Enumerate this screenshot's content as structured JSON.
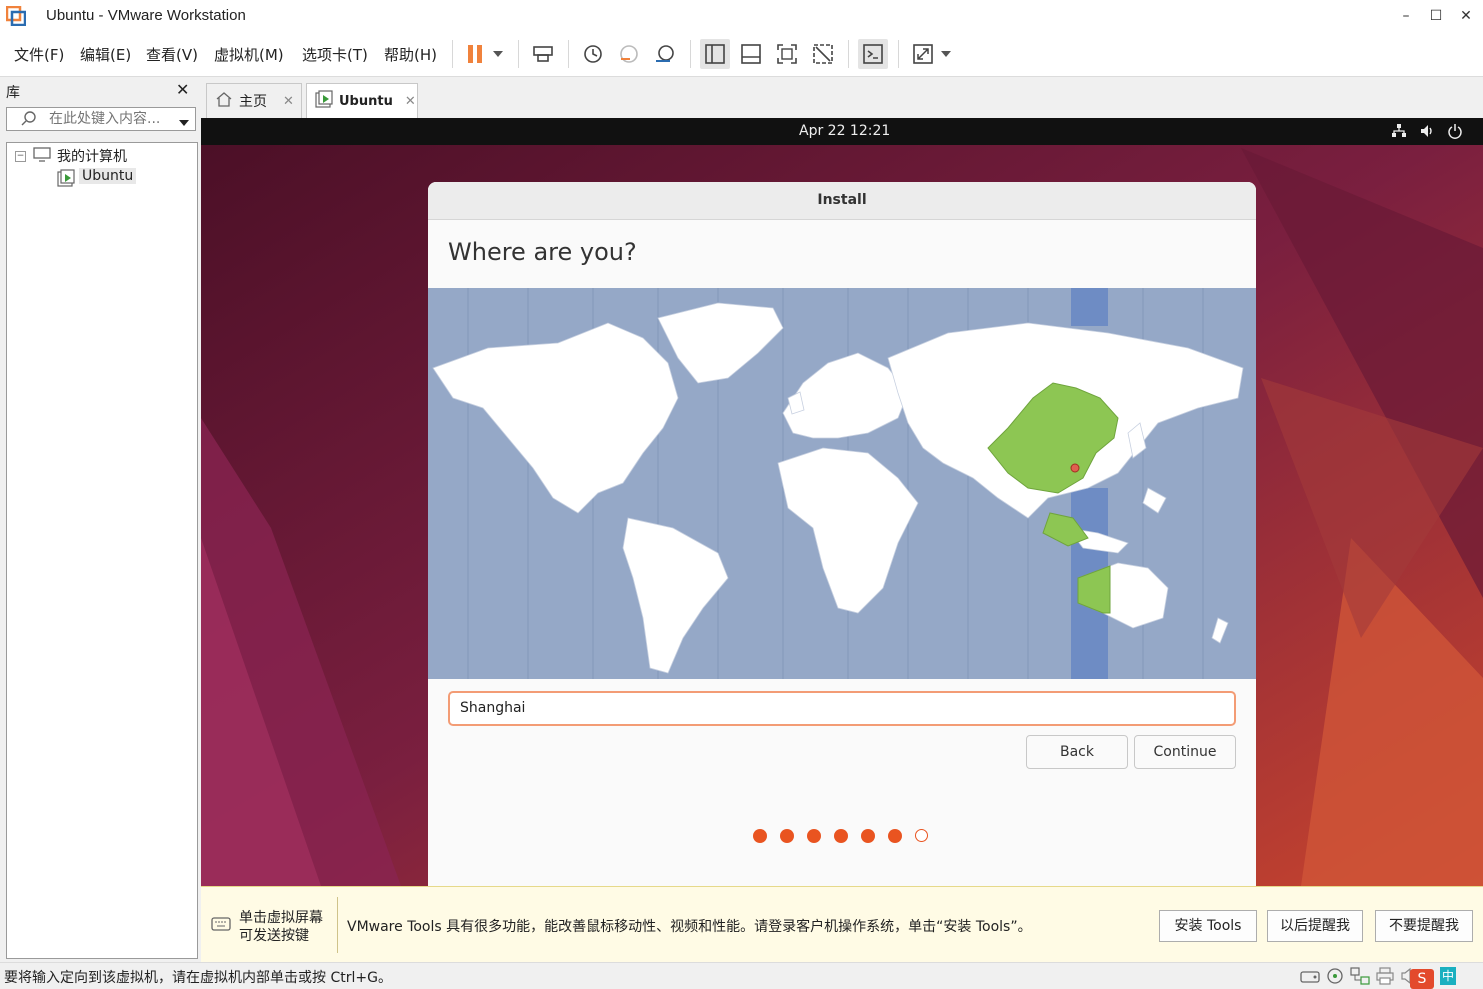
{
  "window": {
    "title": "Ubuntu - VMware Workstation",
    "min": "–",
    "max": "☐",
    "close": "✕"
  },
  "menu": [
    "文件(F)",
    "编辑(E)",
    "查看(V)",
    "虚拟机(M)",
    "选项卡(T)",
    "帮助(H)"
  ],
  "library": {
    "title": "库",
    "close": "✕",
    "search_placeholder": "在此处键入内容...",
    "tree": {
      "root": "我的计算机",
      "child": "Ubuntu"
    }
  },
  "tabs": [
    {
      "label": "主页"
    },
    {
      "label": "Ubuntu"
    }
  ],
  "guest": {
    "clock": "Apr 22  12:21",
    "dialog_title": "Install",
    "heading": "Where are you?",
    "timezone_value": "Shanghai",
    "back_label": "Back",
    "continue_label": "Continue",
    "progress_total": 7,
    "progress_done": 6
  },
  "notice": {
    "hint_line1": "单击虚拟屏幕",
    "hint_line2": "可发送按键",
    "message": "VMware Tools 具有很多功能，能改善鼠标移动性、视频和性能。请登录客户机操作系统，单击“安装 Tools”。",
    "install_label": "安装 Tools",
    "later_label": "以后提醒我",
    "never_label": "不要提醒我"
  },
  "status": {
    "text": "要将输入定向到该虚拟机，请在虚拟机内部单击或按 Ctrl+G。",
    "ime": "中"
  },
  "colors": {
    "accent": "#e95420",
    "selected_tz": "#8dc653",
    "ocean": "#95a8c7",
    "tz_band": "#6e8cc4",
    "vmware_orange": "#f0823c"
  }
}
